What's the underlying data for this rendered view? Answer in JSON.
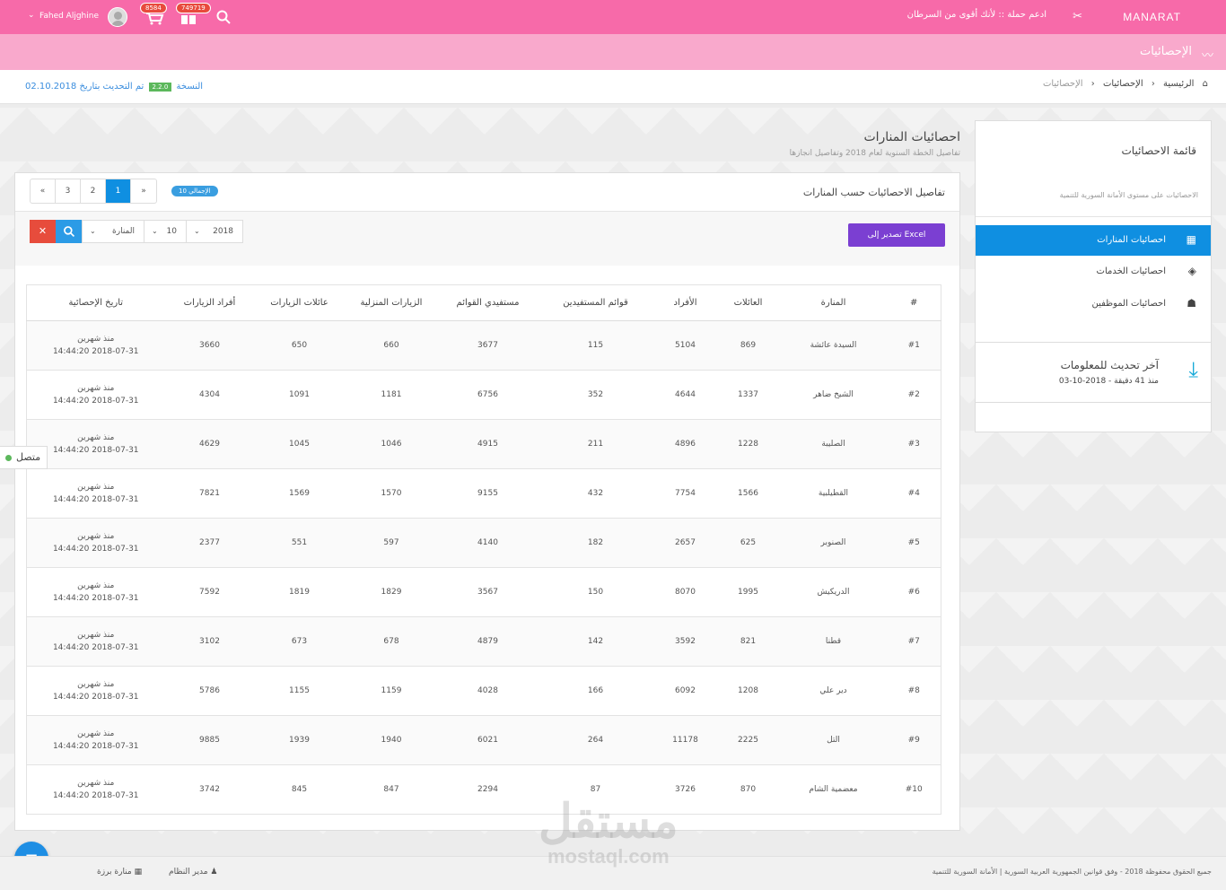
{
  "topbar": {
    "brand": "MANARAT",
    "campaign": "ادعم حملة :: لأنك أقوى من السرطان",
    "badge_cart": "749719",
    "badge_orders": "8584",
    "username": "Fahed Aljghine"
  },
  "subbar": {
    "title": "الإحصائيات"
  },
  "breadcrumb": {
    "home": "الرئيسية",
    "level1": "الإحصائيات",
    "level2": "الإحصائيات"
  },
  "version": {
    "label": "النسخة",
    "number": "2.2.0",
    "updated": "تم التحديث بتاريخ 02.10.2018"
  },
  "sidebar": {
    "title": "قائمة الاحصائيات",
    "subtitle": "الاحصائيات على مستوى الأمانة السورية للتنمية",
    "items": [
      {
        "label": "احصائيات المنارات"
      },
      {
        "label": "احصائيات الخدمات"
      },
      {
        "label": "احصائيات الموظفين"
      }
    ],
    "update_title": "آخر تحديث للمعلومات",
    "update_sub": "منذ 41 دقيقة - 2018-10-03"
  },
  "main": {
    "title": "احصائيات المنارات",
    "subtitle": "تفاصيل الخطة السنوية لعام 2018 وتفاصيل انجازها"
  },
  "panel": {
    "title": "تفاصيل الاحصائيات حسب المنارات",
    "total_label": "الإجمالي",
    "total": "10",
    "pages": [
      "«",
      "3",
      "2",
      "1",
      "»"
    ],
    "excel": "تصدير إلى Excel",
    "filter_year": "2018",
    "filter_count": "10",
    "filter_center": "المنارة"
  },
  "table": {
    "headers": [
      "#",
      "المنارة",
      "العائلات",
      "الأفراد",
      "قوائم المستفيدين",
      "مستفيدي القوائم",
      "الزيارات المنزلية",
      "عائلات الزيارات",
      "أفراد الزيارات",
      "تاريخ الإحصائية"
    ],
    "rows": [
      [
        "#1",
        "السيدة عائشة",
        "869",
        "5104",
        "115",
        "3677",
        "660",
        "650",
        "3660",
        "منذ شهرين",
        "2018-07-31 14:44:20"
      ],
      [
        "#2",
        "الشيخ ضاهر",
        "1337",
        "4644",
        "352",
        "6756",
        "1181",
        "1091",
        "4304",
        "منذ شهرين",
        "2018-07-31 14:44:20"
      ],
      [
        "#3",
        "الصليبة",
        "1228",
        "4896",
        "211",
        "4915",
        "1046",
        "1045",
        "4629",
        "منذ شهرين",
        "2018-07-31 14:44:20"
      ],
      [
        "#4",
        "القطيلبية",
        "1566",
        "7754",
        "432",
        "9155",
        "1570",
        "1569",
        "7821",
        "منذ شهرين",
        "2018-07-31 14:44:20"
      ],
      [
        "#5",
        "الصنوبر",
        "625",
        "2657",
        "182",
        "4140",
        "597",
        "551",
        "2377",
        "منذ شهرين",
        "2018-07-31 14:44:20"
      ],
      [
        "#6",
        "الدريكيش",
        "1995",
        "8070",
        "150",
        "3567",
        "1829",
        "1819",
        "7592",
        "منذ شهرين",
        "2018-07-31 14:44:20"
      ],
      [
        "#7",
        "قطنا",
        "821",
        "3592",
        "142",
        "4879",
        "678",
        "673",
        "3102",
        "منذ شهرين",
        "2018-07-31 14:44:20"
      ],
      [
        "#8",
        "دير علي",
        "1208",
        "6092",
        "166",
        "4028",
        "1159",
        "1155",
        "5786",
        "منذ شهرين",
        "2018-07-31 14:44:20"
      ],
      [
        "#9",
        "التل",
        "2225",
        "11178",
        "264",
        "6021",
        "1940",
        "1939",
        "9885",
        "منذ شهرين",
        "2018-07-31 14:44:20"
      ],
      [
        "#10",
        "معضمية الشام",
        "870",
        "3726",
        "87",
        "2294",
        "847",
        "845",
        "3742",
        "منذ شهرين",
        "2018-07-31 14:44:20"
      ]
    ]
  },
  "online": "متصل",
  "footer": {
    "copyright": "جميع الحقوق محفوظة 2018 - وفق قوانين الجمهورية العربية السورية | الأمانة السورية للتنمية",
    "admin": "مدير النظام",
    "org": "منارة برزة"
  },
  "watermark": {
    "ar": "مستقل",
    "en": "mostaql.com"
  }
}
